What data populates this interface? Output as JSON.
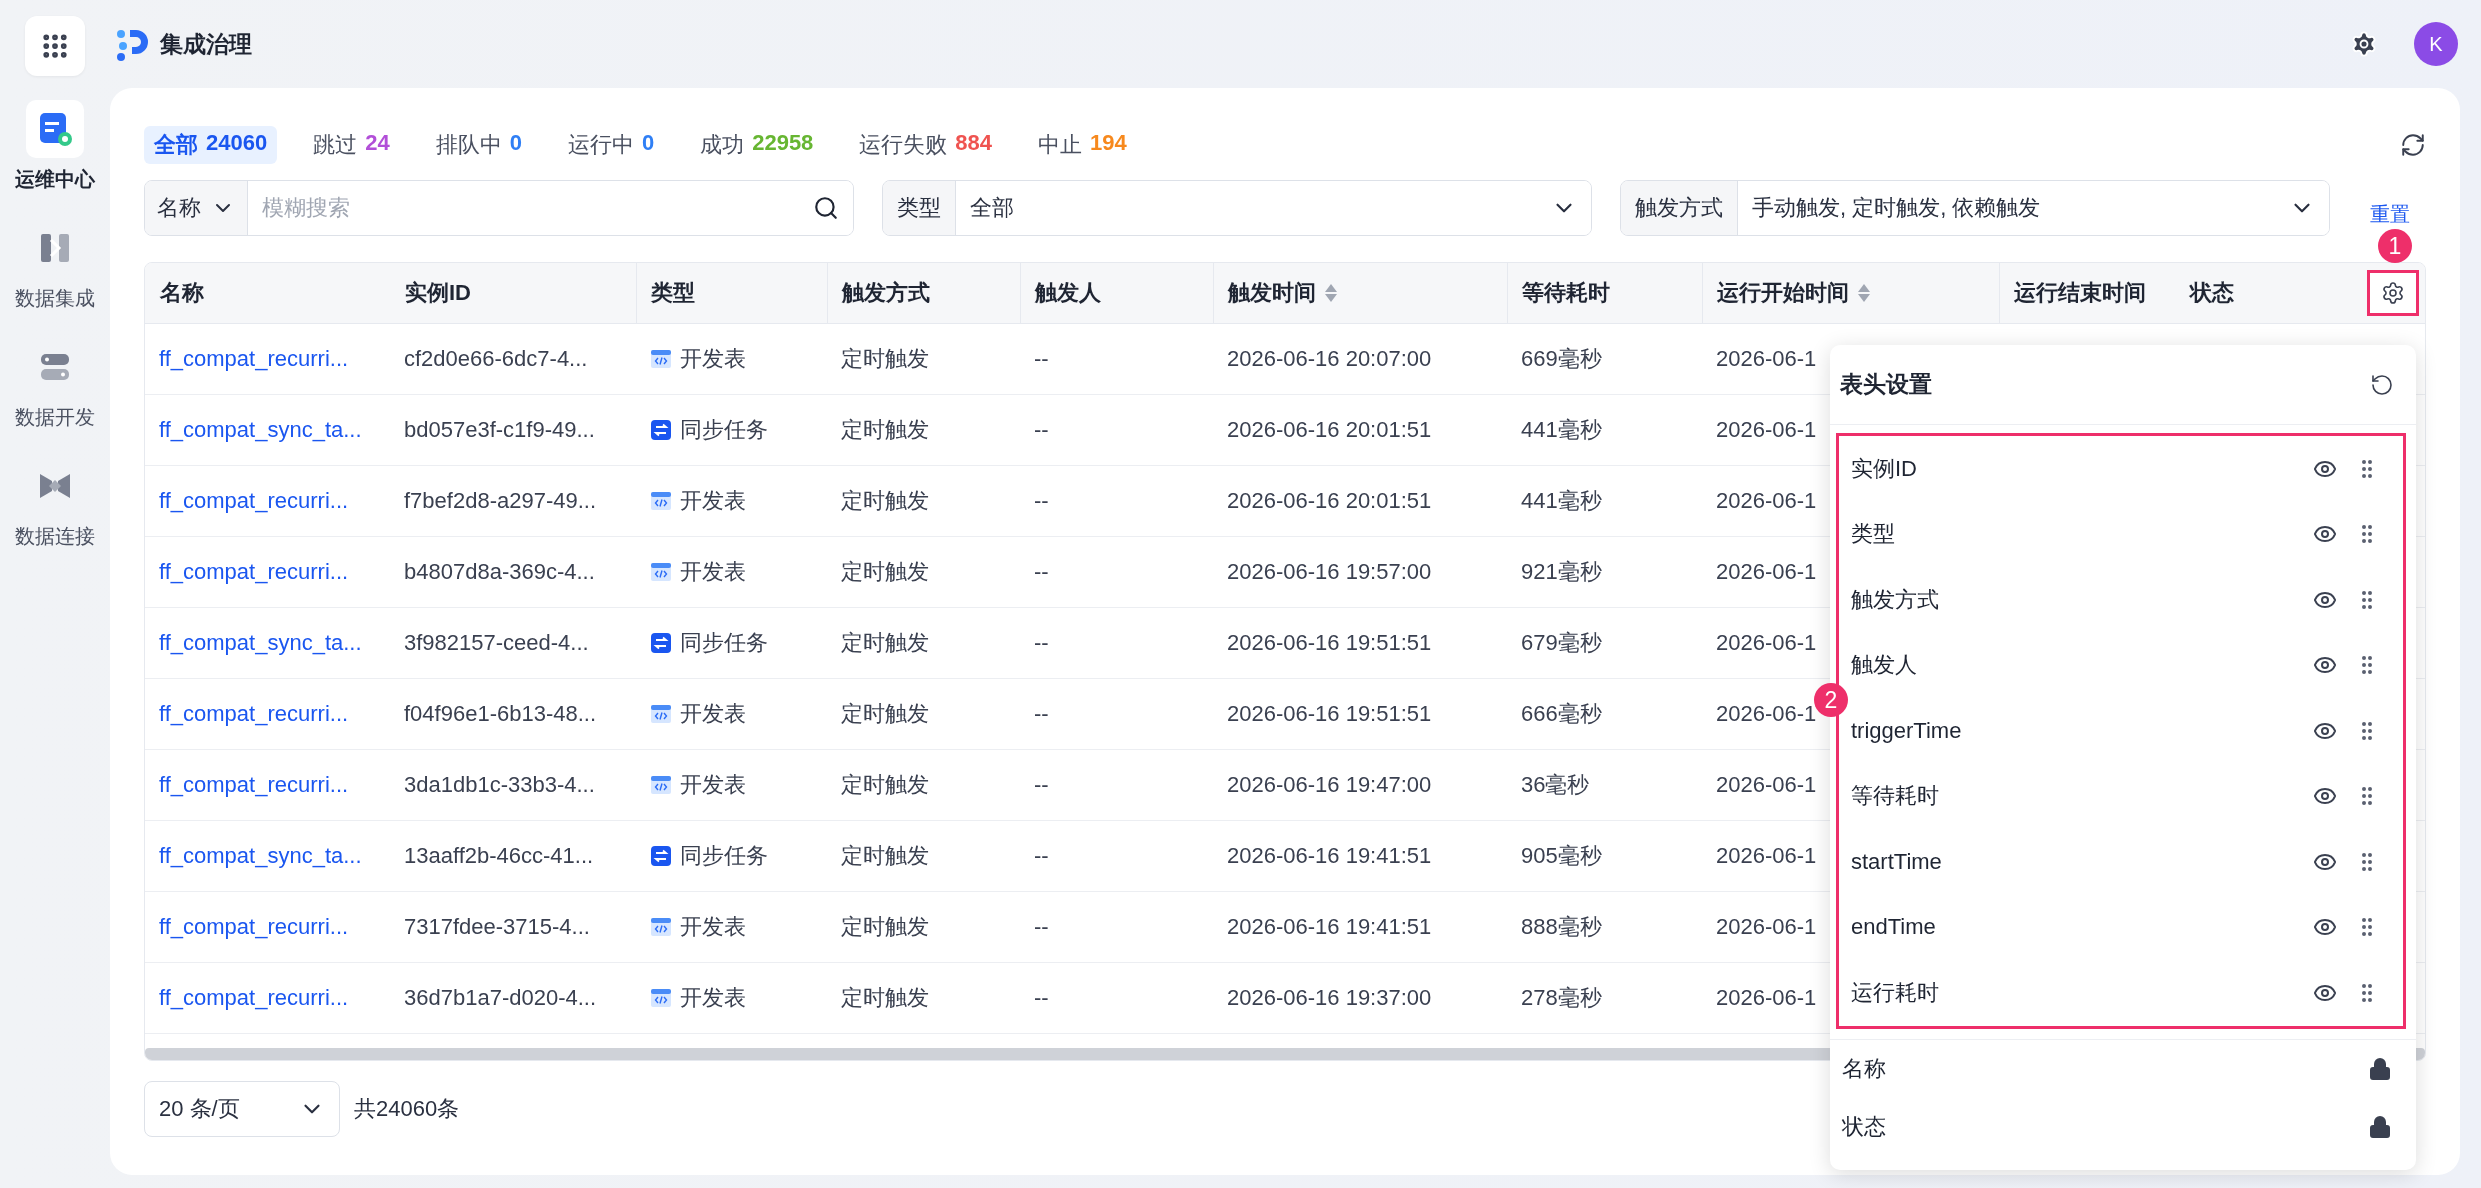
{
  "app": {
    "title": "集成治理"
  },
  "user": {
    "initial": "K"
  },
  "sidebar": {
    "items": [
      {
        "label": "运维中心",
        "selected": true
      },
      {
        "label": "数据集成",
        "selected": false
      },
      {
        "label": "数据开发",
        "selected": false
      },
      {
        "label": "数据连接",
        "selected": false
      }
    ]
  },
  "status_tabs": [
    {
      "label": "全部",
      "count": "24060",
      "selected": true,
      "color": "#1a56f0"
    },
    {
      "label": "跳过",
      "count": "24",
      "selected": false,
      "color": "#b24fd8"
    },
    {
      "label": "排队中",
      "count": "0",
      "selected": false,
      "color": "#2f7ff5"
    },
    {
      "label": "运行中",
      "count": "0",
      "selected": false,
      "color": "#2f7ff5"
    },
    {
      "label": "成功",
      "count": "22958",
      "selected": false,
      "color": "#67b632"
    },
    {
      "label": "运行失败",
      "count": "884",
      "selected": false,
      "color": "#ef5350"
    },
    {
      "label": "中止",
      "count": "194",
      "selected": false,
      "color": "#f7891d"
    }
  ],
  "filters": {
    "name": {
      "label": "名称",
      "placeholder": "模糊搜索"
    },
    "type": {
      "label": "类型",
      "value": "全部"
    },
    "trigger": {
      "label": "触发方式",
      "value": "手动触发, 定时触发, 依赖触发"
    },
    "reset": "重置"
  },
  "table": {
    "columns": [
      {
        "label": "名称",
        "sortable": false
      },
      {
        "label": "实例ID",
        "sortable": false
      },
      {
        "label": "类型",
        "sortable": false
      },
      {
        "label": "触发方式",
        "sortable": false
      },
      {
        "label": "触发人",
        "sortable": false
      },
      {
        "label": "触发时间",
        "sortable": true
      },
      {
        "label": "等待耗时",
        "sortable": false
      },
      {
        "label": "运行开始时间",
        "sortable": true
      },
      {
        "label": "运行结束时间",
        "sortable": false
      },
      {
        "label": "状态",
        "sortable": false
      }
    ],
    "rows": [
      {
        "name": "ff_compat_recurri...",
        "id": "cf2d0e66-6dc7-4...",
        "type": {
          "kind": "dev",
          "label": "开发表"
        },
        "trigger": "定时触发",
        "person": "--",
        "trigger_time": "2026-06-16 20:07:00",
        "wait": "669毫秒",
        "start": "2026-06-1"
      },
      {
        "name": "ff_compat_sync_ta...",
        "id": "bd057e3f-c1f9-49...",
        "type": {
          "kind": "sync",
          "label": "同步任务"
        },
        "trigger": "定时触发",
        "person": "--",
        "trigger_time": "2026-06-16 20:01:51",
        "wait": "441毫秒",
        "start": "2026-06-1"
      },
      {
        "name": "ff_compat_recurri...",
        "id": "f7bef2d8-a297-49...",
        "type": {
          "kind": "dev",
          "label": "开发表"
        },
        "trigger": "定时触发",
        "person": "--",
        "trigger_time": "2026-06-16 20:01:51",
        "wait": "441毫秒",
        "start": "2026-06-1"
      },
      {
        "name": "ff_compat_recurri...",
        "id": "b4807d8a-369c-4...",
        "type": {
          "kind": "dev",
          "label": "开发表"
        },
        "trigger": "定时触发",
        "person": "--",
        "trigger_time": "2026-06-16 19:57:00",
        "wait": "921毫秒",
        "start": "2026-06-1"
      },
      {
        "name": "ff_compat_sync_ta...",
        "id": "3f982157-ceed-4...",
        "type": {
          "kind": "sync",
          "label": "同步任务"
        },
        "trigger": "定时触发",
        "person": "--",
        "trigger_time": "2026-06-16 19:51:51",
        "wait": "679毫秒",
        "start": "2026-06-1"
      },
      {
        "name": "ff_compat_recurri...",
        "id": "f04f96e1-6b13-48...",
        "type": {
          "kind": "dev",
          "label": "开发表"
        },
        "trigger": "定时触发",
        "person": "--",
        "trigger_time": "2026-06-16 19:51:51",
        "wait": "666毫秒",
        "start": "2026-06-1"
      },
      {
        "name": "ff_compat_recurri...",
        "id": "3da1db1c-33b3-4...",
        "type": {
          "kind": "dev",
          "label": "开发表"
        },
        "trigger": "定时触发",
        "person": "--",
        "trigger_time": "2026-06-16 19:47:00",
        "wait": "36毫秒",
        "start": "2026-06-1"
      },
      {
        "name": "ff_compat_sync_ta...",
        "id": "13aaff2b-46cc-41...",
        "type": {
          "kind": "sync",
          "label": "同步任务"
        },
        "trigger": "定时触发",
        "person": "--",
        "trigger_time": "2026-06-16 19:41:51",
        "wait": "905毫秒",
        "start": "2026-06-1"
      },
      {
        "name": "ff_compat_recurri...",
        "id": "7317fdee-3715-4...",
        "type": {
          "kind": "dev",
          "label": "开发表"
        },
        "trigger": "定时触发",
        "person": "--",
        "trigger_time": "2026-06-16 19:41:51",
        "wait": "888毫秒",
        "start": "2026-06-1"
      },
      {
        "name": "ff_compat_recurri...",
        "id": "36d7b1a7-d020-4...",
        "type": {
          "kind": "dev",
          "label": "开发表"
        },
        "trigger": "定时触发",
        "person": "--",
        "trigger_time": "2026-06-16 19:37:00",
        "wait": "278毫秒",
        "start": "2026-06-1"
      }
    ]
  },
  "pagination": {
    "page_size": "20 条/页",
    "total": "共24060条"
  },
  "column_settings": {
    "title": "表头设置",
    "columns": [
      {
        "label": "实例ID",
        "visible": true
      },
      {
        "label": "类型",
        "visible": true
      },
      {
        "label": "触发方式",
        "visible": true
      },
      {
        "label": "触发人",
        "visible": true
      },
      {
        "label": "triggerTime",
        "visible": true
      },
      {
        "label": "等待耗时",
        "visible": true
      },
      {
        "label": "startTime",
        "visible": true
      },
      {
        "label": "endTime",
        "visible": true
      },
      {
        "label": "运行耗时",
        "visible": true
      }
    ],
    "locked": [
      "名称",
      "状态"
    ]
  },
  "markers": [
    "1",
    "2"
  ]
}
